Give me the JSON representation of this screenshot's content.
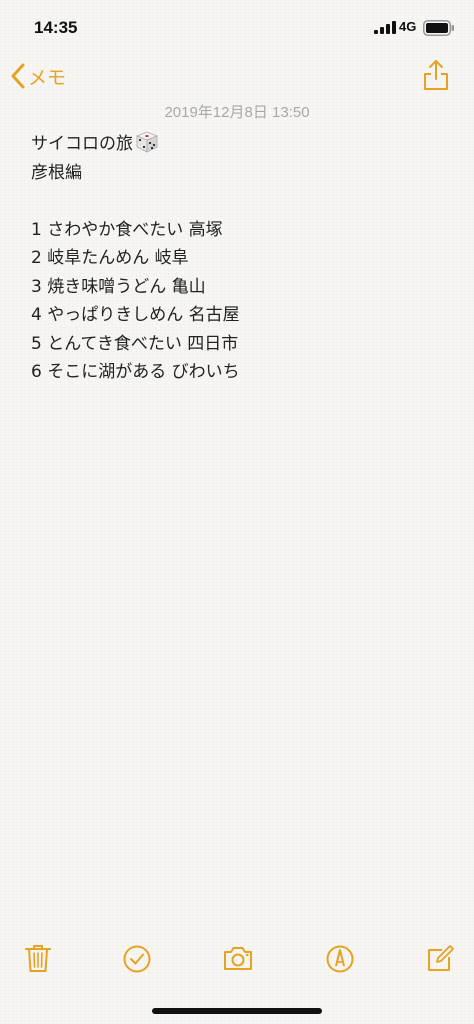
{
  "status_bar": {
    "time": "14:35",
    "network": "4G",
    "icons": [
      "signal-icon",
      "battery-icon"
    ]
  },
  "nav": {
    "back_label": "メモ",
    "back_icon": "chevron-left-icon",
    "share_icon": "share-icon"
  },
  "note": {
    "timestamp": "2019年12月8日 13:50",
    "title": "サイコロの旅",
    "title_icon": "dice-icon",
    "lines": [
      "彦根編",
      "",
      "1 さわやか食べたい 高塚",
      "2 岐阜たんめん 岐阜",
      "3 焼き味噌うどん 亀山",
      "4 やっぱりきしめん 名古屋",
      "5 とんてき食べたい 四日市",
      "6 そこに湖がある びわいち"
    ]
  },
  "toolbar": {
    "icons": [
      "trash-icon",
      "checklist-icon",
      "camera-icon",
      "markup-icon",
      "compose-icon"
    ]
  },
  "colors": {
    "accent": "#e5a223",
    "background": "#f7f6f3",
    "text": "#222222",
    "timestamp": "#a8a8a8"
  }
}
